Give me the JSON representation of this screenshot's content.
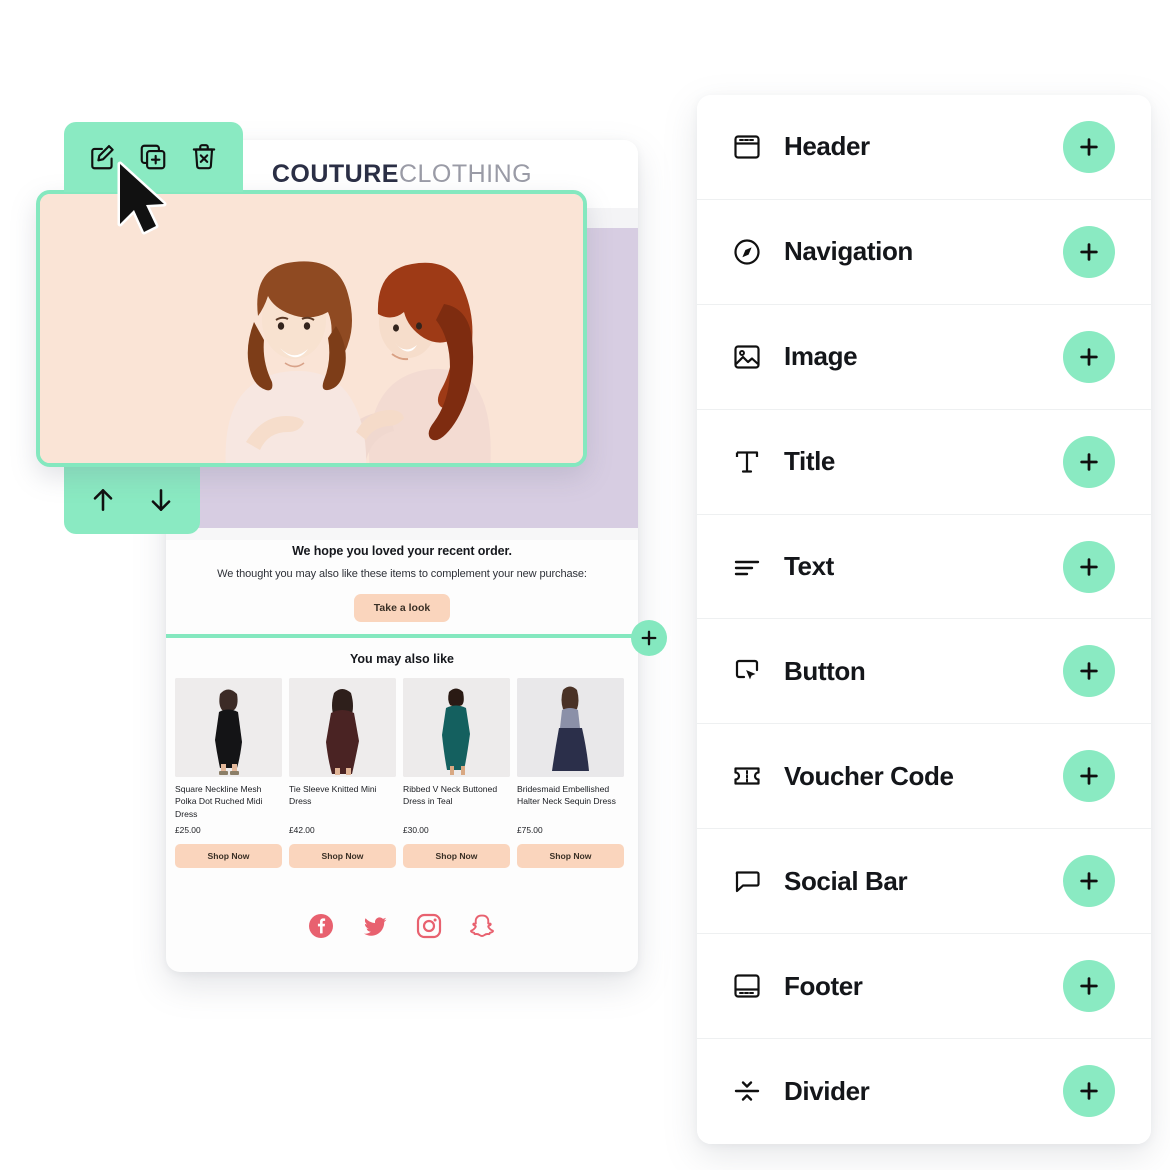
{
  "colors": {
    "mint": "#8aeac2",
    "mint_border": "#84e8bf",
    "peach": "#fad5bd",
    "hero_bg": "#fae4d6",
    "lavender": "#d7cde2",
    "social_pink": "#e8616f",
    "panel_bg": "#ffffff",
    "text_dark": "#14161a"
  },
  "email": {
    "brand": {
      "strong": "COUTURE",
      "light": "CLOTHING"
    },
    "promo": {
      "heading": "We hope you loved your recent order.",
      "subtext": "We thought you may also like these items to complement your new purchase:",
      "cta_label": "Take a look"
    },
    "recommendations": {
      "title": "You may also like",
      "products": [
        {
          "name": "Square Neckline Mesh Polka Dot Ruched Midi Dress",
          "price": "£25.00",
          "cta": "Shop Now",
          "image": "black-midi-dress"
        },
        {
          "name": "Tie Sleeve Knitted Mini Dress",
          "price": "£42.00",
          "cta": "Shop Now",
          "image": "burgundy-mini-dress"
        },
        {
          "name": "Ribbed V Neck Buttoned Dress in Teal",
          "price": "£30.00",
          "cta": "Shop Now",
          "image": "teal-ribbed-dress"
        },
        {
          "name": "Bridesmaid Embellished Halter Neck Sequin Dress",
          "price": "£75.00",
          "cta": "Shop Now",
          "image": "navy-sequin-dress"
        }
      ]
    },
    "social": [
      {
        "name": "facebook-icon"
      },
      {
        "name": "twitter-icon"
      },
      {
        "name": "instagram-icon"
      },
      {
        "name": "snapchat-icon"
      }
    ],
    "hero": {
      "image": "two-smiling-women-photo",
      "selected": true
    }
  },
  "toolbars": {
    "top": [
      {
        "name": "edit-block-icon",
        "label": "Edit"
      },
      {
        "name": "duplicate-block-icon",
        "label": "Duplicate"
      },
      {
        "name": "delete-block-icon",
        "label": "Delete"
      }
    ],
    "bottom": [
      {
        "name": "move-block-up-icon",
        "label": "Move up"
      },
      {
        "name": "move-block-down-icon",
        "label": "Move down"
      }
    ]
  },
  "divider_insert": {
    "label": "+",
    "name": "insert-block-button"
  },
  "block_panel": {
    "add_symbol": "+",
    "rows": [
      {
        "label": "Header",
        "icon": "header-icon"
      },
      {
        "label": "Navigation",
        "icon": "navigation-icon"
      },
      {
        "label": "Image",
        "icon": "image-icon"
      },
      {
        "label": "Title",
        "icon": "title-icon"
      },
      {
        "label": "Text",
        "icon": "text-icon"
      },
      {
        "label": "Button",
        "icon": "button-icon"
      },
      {
        "label": "Voucher Code",
        "icon": "voucher-code-icon"
      },
      {
        "label": "Social Bar",
        "icon": "social-bar-icon"
      },
      {
        "label": "Footer",
        "icon": "footer-icon"
      },
      {
        "label": "Divider",
        "icon": "divider-icon"
      }
    ]
  }
}
